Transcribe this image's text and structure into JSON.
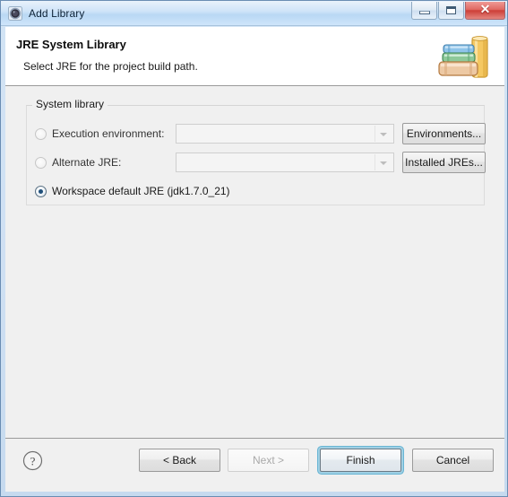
{
  "window": {
    "title": "Add Library",
    "app_icon": "eclipse-icon",
    "controls": {
      "minimize": "minimize-icon",
      "maximize": "maximize-icon",
      "close": "close-icon",
      "close_glyph": "✕"
    }
  },
  "header": {
    "title": "JRE System Library",
    "subtitle": "Select JRE for the project build path.",
    "banner_image": "books-stack-image"
  },
  "group": {
    "label": "System library",
    "rows": [
      {
        "id": "execution-environment",
        "radio_label": "Execution environment:",
        "selected": false,
        "enabled": false,
        "combo_value": "",
        "combo_placeholder": "",
        "button_label": "Environments..."
      },
      {
        "id": "alternate-jre",
        "radio_label": "Alternate JRE:",
        "selected": false,
        "enabled": false,
        "combo_value": "",
        "combo_placeholder": "",
        "button_label": "Installed JREs..."
      },
      {
        "id": "workspace-default-jre",
        "radio_label": "Workspace default JRE (jdk1.7.0_21)",
        "selected": true,
        "enabled": true
      }
    ]
  },
  "footer": {
    "help_icon": "help-question-icon",
    "buttons": [
      {
        "id": "back",
        "label": "< Back",
        "enabled": true,
        "default": false
      },
      {
        "id": "next",
        "label": "Next >",
        "enabled": false,
        "default": false
      },
      {
        "id": "finish",
        "label": "Finish",
        "enabled": true,
        "default": true
      },
      {
        "id": "cancel",
        "label": "Cancel",
        "enabled": true,
        "default": false
      }
    ]
  },
  "colors": {
    "titlebar_blue": "#cfe4f8",
    "window_border": "#6a8db3",
    "dialog_bg": "#f0f0f0",
    "header_bg": "#ffffff",
    "close_red": "#cd3f38",
    "focus_ring": "#69b5d4",
    "radio_dot": "#1f4e79"
  }
}
